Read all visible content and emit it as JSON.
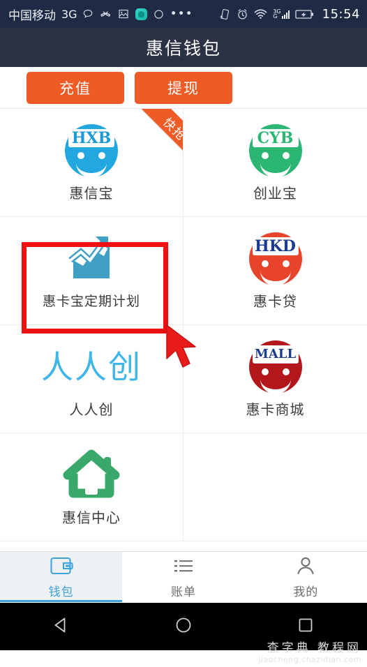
{
  "status_bar": {
    "carrier": "中国移动",
    "network": "3G",
    "time": "15:54",
    "left_icons": [
      "message-bubble-icon",
      "missed-call-icon",
      "gallery-icon",
      "app-badge-icon",
      "circle-icon",
      "more-dots-icon"
    ],
    "right_icons": [
      "vibrate-icon",
      "alarm-clock-icon",
      "wifi-icon",
      "signal-3g-icon",
      "battery-icon"
    ],
    "signal_label_top": "3G",
    "signal_label_bottom": "G",
    "background": "#1f2a44"
  },
  "title_bar": {
    "title": "惠信钱包",
    "background": "#2b3245"
  },
  "action_bar": {
    "recharge_label": "充值",
    "withdraw_label": "提现",
    "button_color": "#ef5b24"
  },
  "grid": {
    "items": [
      {
        "label": "惠信宝",
        "logo_type": "smiley",
        "logo_text": "HXB",
        "logo_color": "#22a7e0",
        "logo_text_color": "#1a9ad6",
        "badge": "快抢",
        "badge_color": "#ef5b24"
      },
      {
        "label": "创业宝",
        "logo_type": "smiley",
        "logo_text": "CYB",
        "logo_color": "#2bb673",
        "logo_text_color": "#2bb673",
        "badge": "",
        "badge_color": ""
      },
      {
        "label": "惠卡宝定期计划",
        "logo_type": "chart",
        "logo_text": "",
        "logo_color": "#3f9fc4",
        "logo_text_color": "",
        "badge": "",
        "badge_color": "",
        "highlighted": true,
        "highlight_color": "#ee1111"
      },
      {
        "label": "惠卡贷",
        "logo_type": "smiley",
        "logo_text": "HKD",
        "logo_color": "#e8442c",
        "logo_text_color": "#1c3d8f",
        "badge": "",
        "badge_color": ""
      },
      {
        "label": "人人创",
        "logo_type": "text",
        "logo_text": "人人创",
        "logo_color": "#3fb6e8",
        "logo_text_color": "#3fb6e8",
        "badge": "",
        "badge_color": ""
      },
      {
        "label": "惠卡商城",
        "logo_type": "smiley",
        "logo_text": "MALL",
        "logo_color": "#b3171c",
        "logo_text_color": "#1c3d8f",
        "badge": "",
        "badge_color": ""
      },
      {
        "label": "惠信中心",
        "logo_type": "house",
        "logo_text": "",
        "logo_color": "#3aa86a",
        "logo_text_color": "",
        "badge": "",
        "badge_color": ""
      }
    ]
  },
  "tab_bar": {
    "tabs": [
      {
        "label": "钱包",
        "icon": "wallet-icon",
        "active": true
      },
      {
        "label": "账单",
        "icon": "list-icon",
        "active": false
      },
      {
        "label": "我的",
        "icon": "person-icon",
        "active": false
      }
    ],
    "active_color": "#3fa3e0",
    "inactive_color": "#6d6d6d"
  },
  "nav_bar": {
    "back": "back-triangle-icon",
    "home": "home-circle-icon",
    "recents": "recents-square-icon"
  },
  "watermark": {
    "line1": "查字典 教程网",
    "line2": "jiaocheng.chazidian.com"
  },
  "cursor": {
    "color": "#e81b1b"
  }
}
